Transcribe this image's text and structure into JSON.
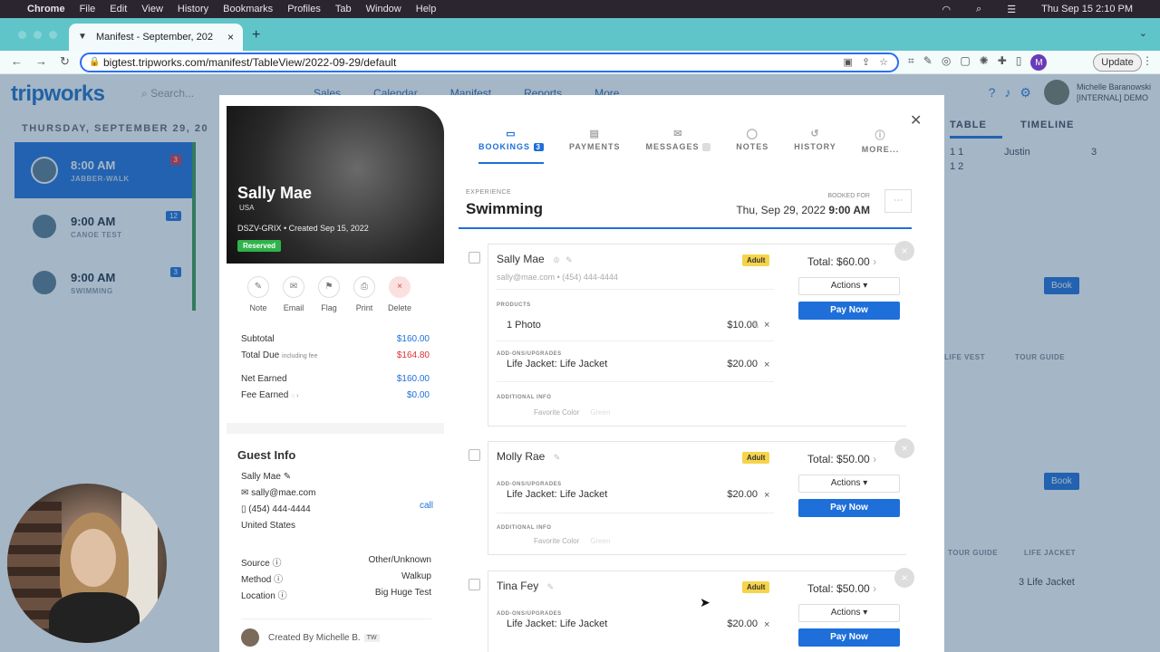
{
  "mac": {
    "apple": "",
    "app": "Chrome",
    "menu": [
      "File",
      "Edit",
      "View",
      "History",
      "Bookmarks",
      "Profiles",
      "Tab",
      "Window",
      "Help"
    ],
    "clock": "Thu Sep 15  2:10 PM"
  },
  "browser": {
    "tab_title": "Manifest - September, 202",
    "url": "bigtest.tripworks.com/manifest/TableView/2022-09-29/default",
    "update_label": "Update",
    "profile_letter": "M"
  },
  "app": {
    "logo": "tripworks",
    "search_placeholder": "Search...",
    "nav": [
      "Sales",
      "Calendar",
      "Manifest",
      "Reports",
      "More"
    ],
    "user_name": "Michelle Baranowski",
    "user_org": "[INTERNAL] DEMO",
    "date": "THURSDAY, SEPTEMBER 29, 20"
  },
  "schedule": [
    {
      "time": "8:00 AM",
      "name": "JABBER-WALK",
      "count": "3"
    },
    {
      "time": "9:00 AM",
      "name": "CANOE TEST",
      "count": "12"
    },
    {
      "time": "9:00 AM",
      "name": "SWIMMING",
      "count": "3"
    }
  ],
  "right_panel": {
    "tab_table": "TABLE",
    "tab_timeline": "TIMELINE",
    "row1": "1 1",
    "row2": "1 2",
    "guide": "Justin",
    "guide_count": "3",
    "book": "Book",
    "h_vest": "LIFE VEST",
    "h_guide": "TOUR GUIDE",
    "h_guide2": "TOUR GUIDE",
    "h_jacket": "LIFE JACKET",
    "jacket_count": "3",
    "jacket": "Life Jacket"
  },
  "guest": {
    "name": "Sally Mae",
    "country": "USA",
    "meta": "DSZV-GRIX • Created Sep 15, 2022",
    "status": "Reserved",
    "actions": [
      "Note",
      "Email",
      "Flag",
      "Print",
      "Delete"
    ],
    "subtotal_label": "Subtotal",
    "subtotal": "$160.00",
    "total_due_label": "Total Due",
    "total_due_note": "including fee",
    "total_due": "$164.80",
    "net_label": "Net Earned",
    "net": "$160.00",
    "fee_label": "Fee Earned",
    "fee": "$0.00",
    "info_title": "Guest Info",
    "info_name": "Sally Mae",
    "email": "sally@mae.com",
    "phone": "(454) 444-4444",
    "call": "call",
    "country_full": "United States",
    "source_label": "Source",
    "source": "Other/Unknown",
    "method_label": "Method",
    "method": "Walkup",
    "location_label": "Location",
    "location": "Big Huge Test",
    "created_by": "Created By Michelle B.",
    "created_tag": "TW"
  },
  "tabs": {
    "bookings": "BOOKINGS",
    "bookings_count": "3",
    "payments": "PAYMENTS",
    "messages": "MESSAGES",
    "notes": "NOTES",
    "history": "HISTORY",
    "more": "MORE..."
  },
  "experience": {
    "label": "EXPERIENCE",
    "title": "Swimming",
    "booked_label": "BOOKED FOR",
    "date": "Thu, Sep 29, 2022",
    "time": "9:00 AM"
  },
  "bookings": [
    {
      "name": "Sally Mae",
      "contact": "sally@mae.com • (454) 444-4444",
      "type": "Adult",
      "products_label": "PRODUCTS",
      "product": "1 Photo",
      "product_price": "$10.00",
      "addons_label": "ADD-ONS/UPGRADES",
      "addon": "Life Jacket: Life Jacket",
      "addon_price": "$20.00",
      "info_label": "ADDITIONAL INFO",
      "fav_label": "Favorite Color",
      "fav": "Green",
      "total": "Total: $60.00",
      "actions": "Actions",
      "pay": "Pay Now"
    },
    {
      "name": "Molly Rae",
      "type": "Adult",
      "addons_label": "ADD-ONS/UPGRADES",
      "addon": "Life Jacket: Life Jacket",
      "addon_price": "$20.00",
      "info_label": "ADDITIONAL INFO",
      "fav_label": "Favorite Color",
      "fav": "Green",
      "total": "Total: $50.00",
      "actions": "Actions",
      "pay": "Pay Now"
    },
    {
      "name": "Tina Fey",
      "type": "Adult",
      "addons_label": "ADD-ONS/UPGRADES",
      "addon": "Life Jacket: Life Jacket",
      "addon_price": "$20.00",
      "total": "Total: $50.00",
      "actions": "Actions",
      "pay": "Pay Now"
    }
  ]
}
